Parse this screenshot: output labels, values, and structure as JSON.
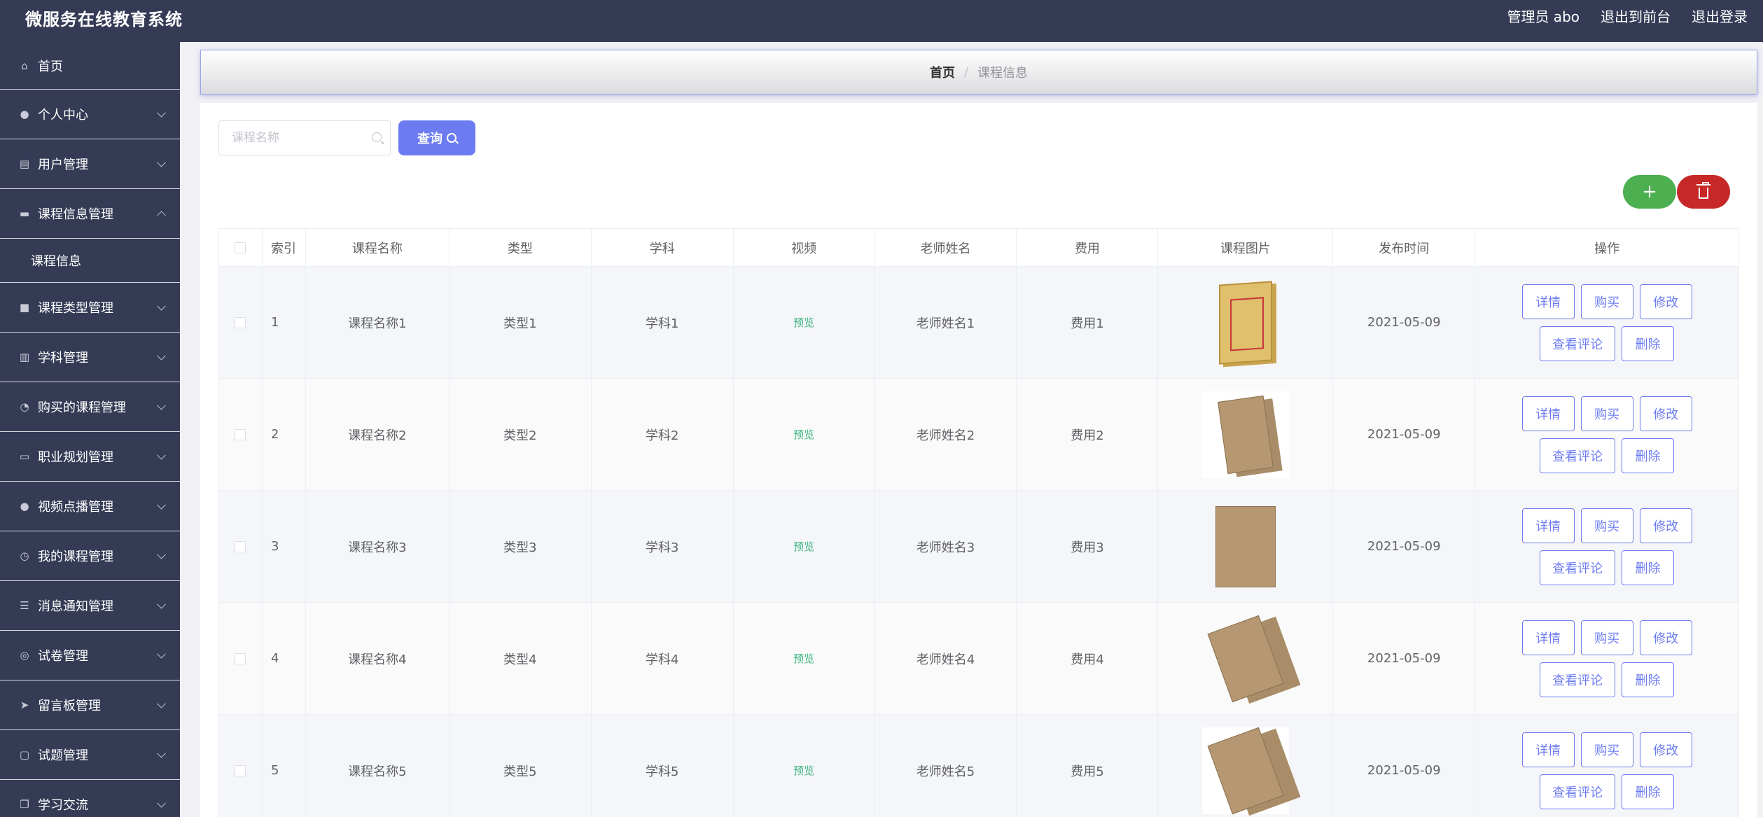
{
  "app": {
    "title": "微服务在线教育系统"
  },
  "header_links": {
    "admin": "管理员 abo",
    "front": "退出到前台",
    "logout": "退出登录"
  },
  "sidebar": {
    "home": "首页",
    "items": [
      {
        "label": "个人中心"
      },
      {
        "label": "用户管理"
      },
      {
        "label": "课程信息管理",
        "expanded": true,
        "sub": "课程信息"
      },
      {
        "label": "课程类型管理"
      },
      {
        "label": "学科管理"
      },
      {
        "label": "购买的课程管理"
      },
      {
        "label": "职业规划管理"
      },
      {
        "label": "视频点播管理"
      },
      {
        "label": "我的课程管理"
      },
      {
        "label": "消息通知管理"
      },
      {
        "label": "试卷管理"
      },
      {
        "label": "留言板管理"
      },
      {
        "label": "试题管理"
      },
      {
        "label": "学习交流"
      }
    ]
  },
  "breadcrumb": {
    "home": "首页",
    "sep": "/",
    "current": "课程信息"
  },
  "search": {
    "placeholder": "课程名称",
    "button": "查询"
  },
  "actions": {
    "add": "+"
  },
  "table": {
    "headers": [
      "索引",
      "课程名称",
      "类型",
      "学科",
      "视频",
      "老师姓名",
      "费用",
      "课程图片",
      "发布时间",
      "操作"
    ],
    "op_labels": {
      "detail": "详情",
      "buy": "购买",
      "edit": "修改",
      "comments": "查看评论",
      "delete": "删除"
    },
    "rows": [
      {
        "index": "1",
        "name": "课程名称1",
        "type": "类型1",
        "subject": "学科1",
        "video": "预览",
        "teacher": "老师姓名1",
        "fee": "费用1",
        "date": "2021-05-09"
      },
      {
        "index": "2",
        "name": "课程名称2",
        "type": "类型2",
        "subject": "学科2",
        "video": "预览",
        "teacher": "老师姓名2",
        "fee": "费用2",
        "date": "2021-05-09"
      },
      {
        "index": "3",
        "name": "课程名称3",
        "type": "类型3",
        "subject": "学科3",
        "video": "预览",
        "teacher": "老师姓名3",
        "fee": "费用3",
        "date": "2021-05-09"
      },
      {
        "index": "4",
        "name": "课程名称4",
        "type": "类型4",
        "subject": "学科4",
        "video": "预览",
        "teacher": "老师姓名4",
        "fee": "费用4",
        "date": "2021-05-09"
      },
      {
        "index": "5",
        "name": "课程名称5",
        "type": "类型5",
        "subject": "学科5",
        "video": "预览",
        "teacher": "老师姓名5",
        "fee": "费用5",
        "date": "2021-05-09"
      }
    ]
  },
  "colors": {
    "topbar": "#353b55",
    "accent": "#6c7cf0",
    "add": "#4caf50",
    "delete": "#c62828",
    "preview": "#42b983"
  }
}
